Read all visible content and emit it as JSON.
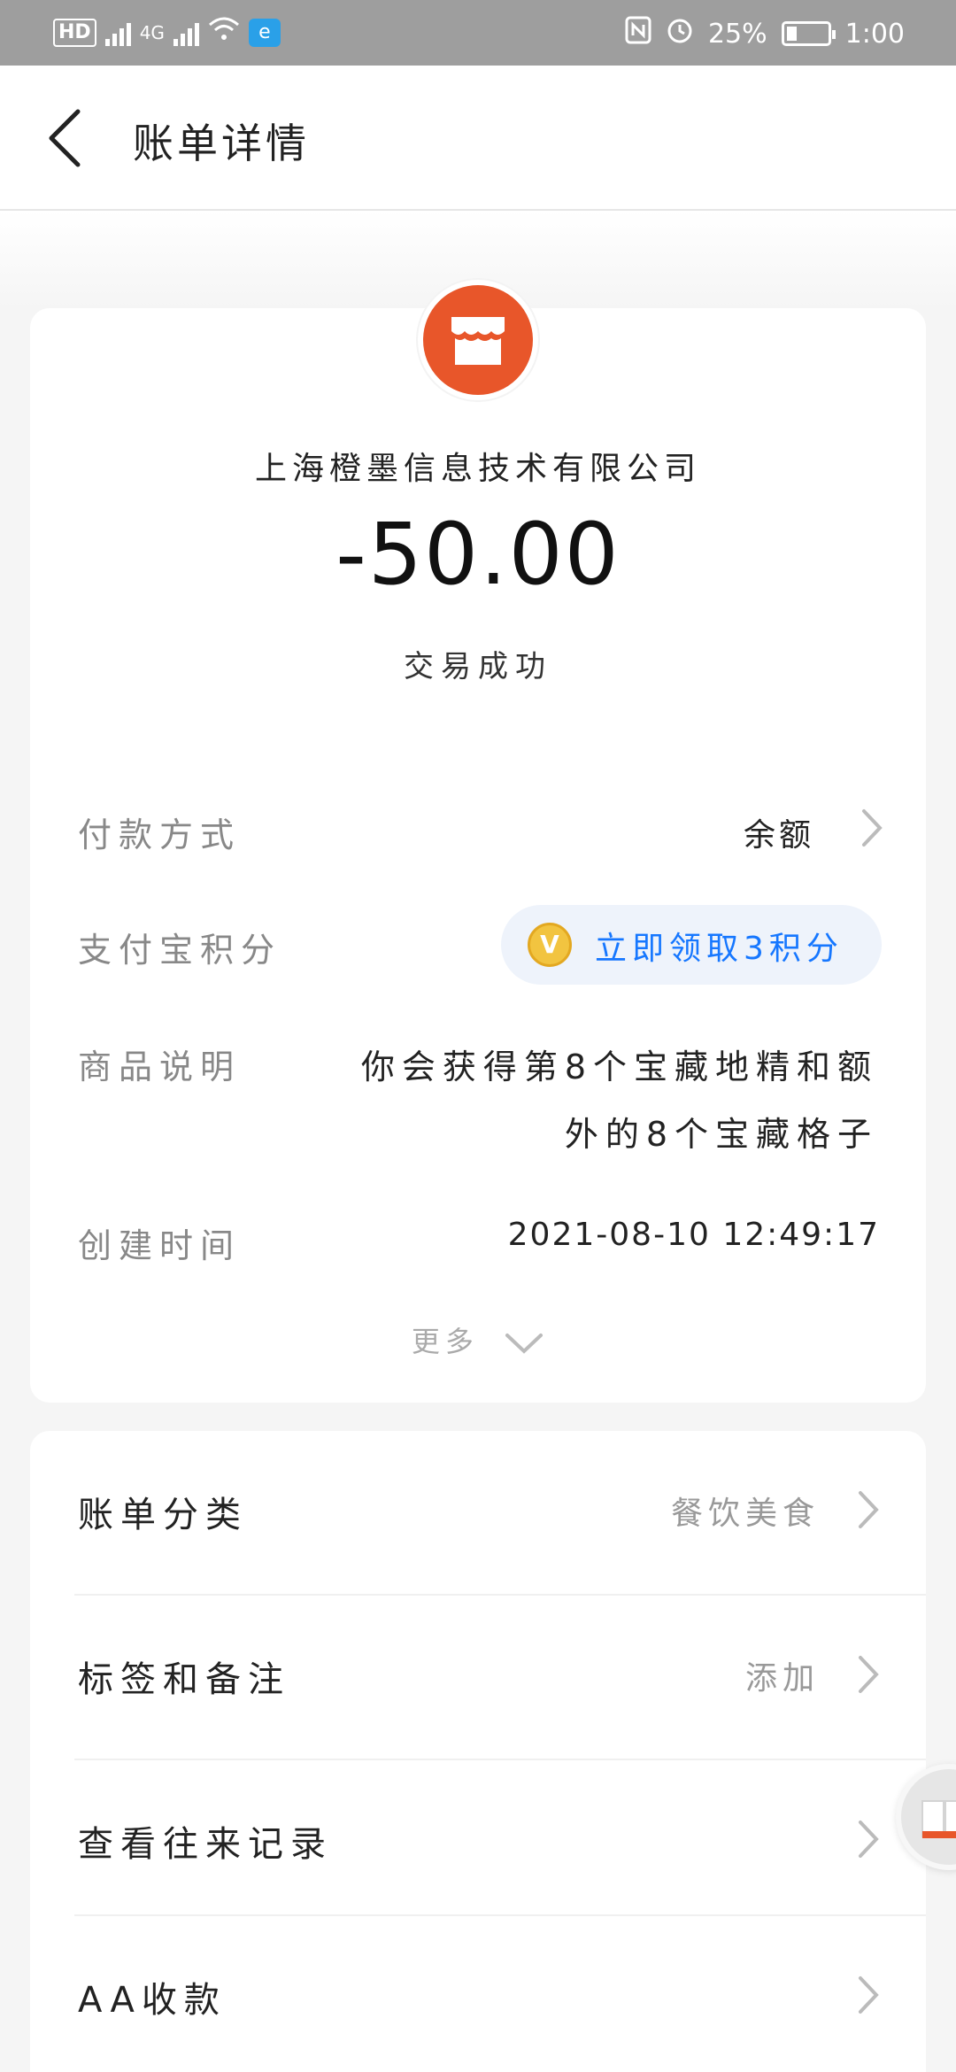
{
  "status_bar": {
    "hd_badge": "HD",
    "network": "4G",
    "battery": "25%",
    "battery_level": 0.25,
    "time": "1:00"
  },
  "header": {
    "title": "账单详情"
  },
  "transaction": {
    "merchant": "上海橙墨信息技术有限公司",
    "amount": "-50.00",
    "status": "交易成功"
  },
  "details": {
    "payment_method": {
      "label": "付款方式",
      "value": "余额"
    },
    "alipay_points": {
      "label": "支付宝积分",
      "button": "立即领取3积分",
      "icon": "V"
    },
    "product_desc": {
      "label": "商品说明",
      "line1": "你会获得第8个宝藏地精和额",
      "line2": "外的8个宝藏格子"
    },
    "created_time": {
      "label": "创建时间",
      "value": "2021-08-10 12:49:17"
    },
    "more_label": "更多"
  },
  "actions": [
    {
      "label": "账单分类",
      "value": "餐饮美食"
    },
    {
      "label": "标签和备注",
      "value": "添加"
    },
    {
      "label": "查看往来记录",
      "value": ""
    },
    {
      "label": "AA收款",
      "value": ""
    }
  ],
  "colors": {
    "merchant_logo": "#e8562a",
    "accent_blue": "#1677ff",
    "points_gold": "#f2c440"
  }
}
